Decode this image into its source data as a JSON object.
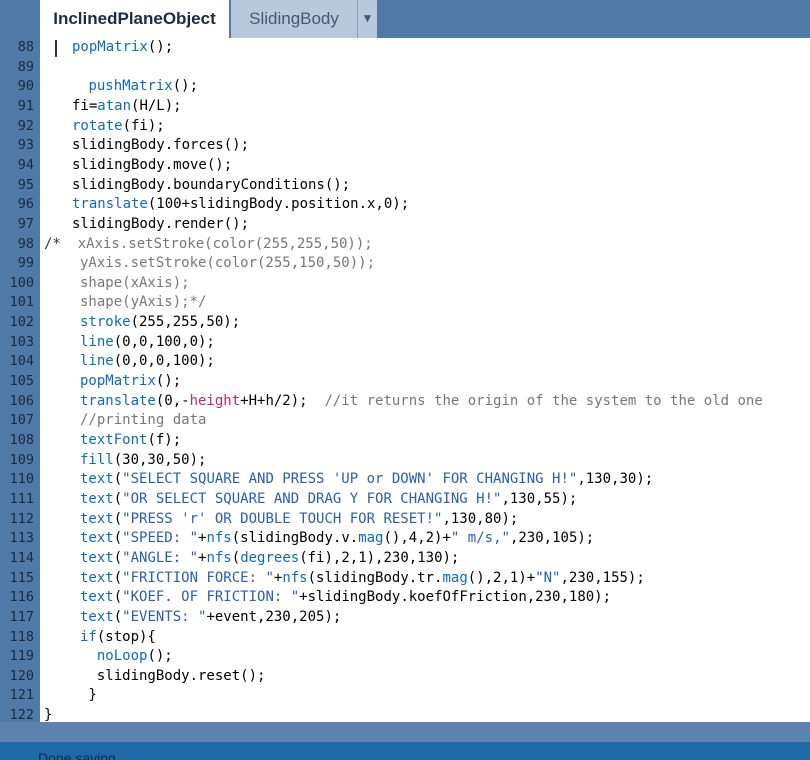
{
  "tabs": [
    {
      "label": "InclinedPlaneObject",
      "active": true
    },
    {
      "label": "SlidingBody",
      "active": false
    }
  ],
  "tab_menu_icon": "triangle-down-icon",
  "current_line": 88,
  "status": {
    "text": "Done saving."
  },
  "colors": {
    "gutter": "#4f7aa8",
    "tab_inactive": "#b9c8da",
    "statusbar": "#1e6aa8",
    "keyword": "#0b6bbd",
    "comment": "#777777"
  },
  "code_lines": [
    {
      "n": "88",
      "text": "popMatrix();"
    },
    {
      "n": "89",
      "text": ""
    },
    {
      "n": "90",
      "text": " pushMatrix();"
    },
    {
      "n": "91",
      "text": "fi=atan(H/L);"
    },
    {
      "n": "92",
      "text": "rotate(fi);"
    },
    {
      "n": "93",
      "text": "slidingBody.forces();"
    },
    {
      "n": "94",
      "text": "slidingBody.move();"
    },
    {
      "n": "95",
      "text": "slidingBody.boundaryConditions();"
    },
    {
      "n": "96",
      "text": "translate(100+slidingBody.position.x,0);"
    },
    {
      "n": "97",
      "text": "slidingBody.render();"
    },
    {
      "n": "98",
      "text": "/*  xAxis.setStroke(color(255,255,50));"
    },
    {
      "n": "99",
      "text": "yAxis.setStroke(color(255,150,50));"
    },
    {
      "n": "100",
      "text": "shape(xAxis);"
    },
    {
      "n": "101",
      "text": "shape(yAxis);*/"
    },
    {
      "n": "102",
      "text": "stroke(255,255,50);"
    },
    {
      "n": "103",
      "text": "line(0,0,100,0);"
    },
    {
      "n": "104",
      "text": "line(0,0,0,100);"
    },
    {
      "n": "105",
      "text": "popMatrix();"
    },
    {
      "n": "106",
      "text": "translate(0,-height+H+h/2);  //it returns the origin of the system to the old one"
    },
    {
      "n": "107",
      "text": "//printing data"
    },
    {
      "n": "108",
      "text": "textFont(f);"
    },
    {
      "n": "109",
      "text": "fill(30,30,50);"
    },
    {
      "n": "110",
      "text": "text(\"SELECT SQUARE AND PRESS 'UP or DOWN' FOR CHANGING H!\",130,30);"
    },
    {
      "n": "111",
      "text": "text(\"OR SELECT SQUARE AND DRAG Y FOR CHANGING H!\",130,55);"
    },
    {
      "n": "112",
      "text": "text(\"PRESS 'r' OR DOUBLE TOUCH FOR RESET!\",130,80);"
    },
    {
      "n": "113",
      "text": "text(\"SPEED: \"+nfs(slidingBody.v.mag(),4,2)+\" m/s,\",230,105);"
    },
    {
      "n": "114",
      "text": "text(\"ANGLE: \"+nfs(degrees(fi),2,1),230,130);"
    },
    {
      "n": "115",
      "text": "text(\"FRICTION FORCE: \"+nfs(slidingBody.tr.mag(),2,1)+\"N\",230,155);"
    },
    {
      "n": "116",
      "text": "text(\"KOEF. OF FRICTION: \"+slidingBody.koefOfFriction,230,180);"
    },
    {
      "n": "117",
      "text": "text(\"EVENTS: \"+event,230,205);"
    },
    {
      "n": "118",
      "text": "if(stop){"
    },
    {
      "n": "119",
      "text": "  noLoop();"
    },
    {
      "n": "120",
      "text": "  slidingBody.reset();"
    },
    {
      "n": "121",
      "text": " }"
    },
    {
      "n": "122",
      "text": "}"
    }
  ]
}
